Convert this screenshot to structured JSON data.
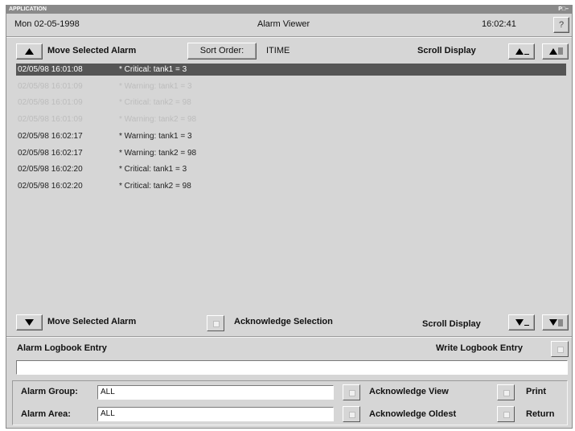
{
  "titlebar": {
    "title": "APPLICATION",
    "controls": "P□–"
  },
  "header": {
    "date": "Mon 02-05-1998",
    "title": "Alarm Viewer",
    "time": "16:02:41",
    "help": "?"
  },
  "toolbar": {
    "move_up_label": "Move Selected Alarm",
    "sort_button": "Sort Order:",
    "sort_value": "ITIME",
    "scroll_label": "Scroll Display"
  },
  "alarms": [
    {
      "time": "02/05/98 16:01:08",
      "message": "* Critical: tank1 = 3",
      "state": "sel"
    },
    {
      "time": "02/05/98 16:01:09",
      "message": "* Warning: tank1 = 3",
      "state": "dim"
    },
    {
      "time": "02/05/98 16:01:09",
      "message": "* Critical: tank2 = 98",
      "state": "dim"
    },
    {
      "time": "02/05/98 16:01:09",
      "message": "* Warning: tank2 = 98",
      "state": "dim"
    },
    {
      "time": "02/05/98 16:02:17",
      "message": "* Warning: tank1 = 3",
      "state": "norm"
    },
    {
      "time": "02/05/98 16:02:17",
      "message": "* Warning: tank2 = 98",
      "state": "norm"
    },
    {
      "time": "02/05/98 16:02:20",
      "message": "* Critical: tank1 = 3",
      "state": "norm"
    },
    {
      "time": "02/05/98 16:02:20",
      "message": "* Critical: tank2 = 98",
      "state": "norm"
    }
  ],
  "bottom_toolbar": {
    "move_down_label": "Move Selected Alarm",
    "ack_selection": "Acknowledge Selection",
    "scroll_label": "Scroll Display"
  },
  "logbook": {
    "label": "Alarm Logbook Entry",
    "write_label": "Write Logbook Entry",
    "value": ""
  },
  "filters": {
    "group_label": "Alarm Group:",
    "group_value": "ALL",
    "area_label": "Alarm Area:",
    "area_value": "ALL",
    "ack_view": "Acknowledge View",
    "ack_oldest": "Acknowledge Oldest",
    "print": "Print",
    "return": "Return"
  },
  "colors": {
    "window_bg": "#d6d6d6",
    "selected_row": "#555555",
    "titlebar": "#8a8a8a"
  }
}
